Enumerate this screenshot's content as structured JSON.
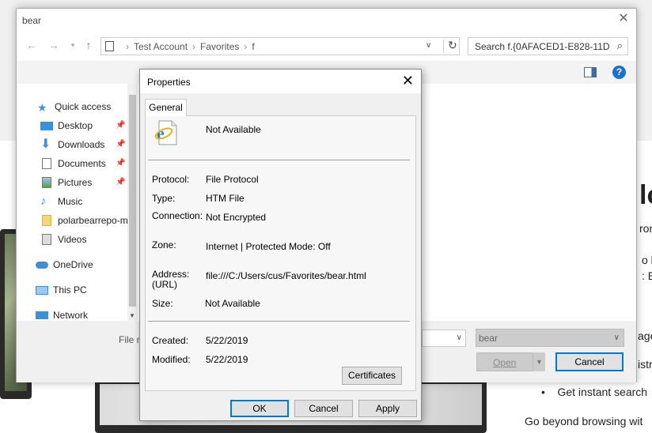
{
  "file_dialog": {
    "title": "bear",
    "breadcrumb": [
      "Test Account",
      "Favorites",
      "f"
    ],
    "search_placeholder": "Search f.{0AFACED1-E828-11D...",
    "sidebar": [
      {
        "label": "Quick access",
        "icon": "star-icon"
      },
      {
        "label": "Desktop",
        "icon": "desktop-folder-icon"
      },
      {
        "label": "Downloads",
        "icon": "download-arrow-icon"
      },
      {
        "label": "Documents",
        "icon": "documents-icon"
      },
      {
        "label": "Pictures",
        "icon": "pictures-icon"
      },
      {
        "label": "Music",
        "icon": "music-note-icon"
      },
      {
        "label": "polarbearrepo-m",
        "icon": "folder-icon"
      },
      {
        "label": "Videos",
        "icon": "videos-icon"
      },
      {
        "label": "OneDrive",
        "icon": "cloud-icon"
      },
      {
        "label": "This PC",
        "icon": "computer-icon"
      },
      {
        "label": "Network",
        "icon": "network-icon"
      }
    ],
    "file_name_label": "File n",
    "file_type_value": "bear",
    "open_label": "Open",
    "cancel_label": "Cancel"
  },
  "properties": {
    "title": "Properties",
    "tab": "General",
    "name_value": "Not Available",
    "rows": [
      {
        "label": "Protocol:",
        "value": "File Protocol"
      },
      {
        "label": "Type:",
        "value": "HTM File"
      },
      {
        "label": "Connection:",
        "value": "Not Encrypted"
      },
      {
        "label": "Zone:",
        "value": "Internet | Protected Mode: Off"
      },
      {
        "label": "Address:",
        "value": "file:///C:/Users/cus/Favorites/bear.html"
      },
      {
        "label": "(URL)",
        "value": ""
      },
      {
        "label": "Size:",
        "value": "Not Available"
      }
    ],
    "created_label": "Created:",
    "created_value": "5/22/2019",
    "modified_label": "Modified:",
    "modified_value": "5/22/2019",
    "certificates_label": "Certificates",
    "ok_label": "OK",
    "cancel_label": "Cancel",
    "apply_label": "Apply"
  },
  "background": {
    "heading_fragment": "lo",
    "lines": [
      "ron",
      "o br",
      ": Ex",
      "age",
      "istr"
    ],
    "bullet": "Get instant search",
    "footer": "Go beyond browsing wit"
  }
}
